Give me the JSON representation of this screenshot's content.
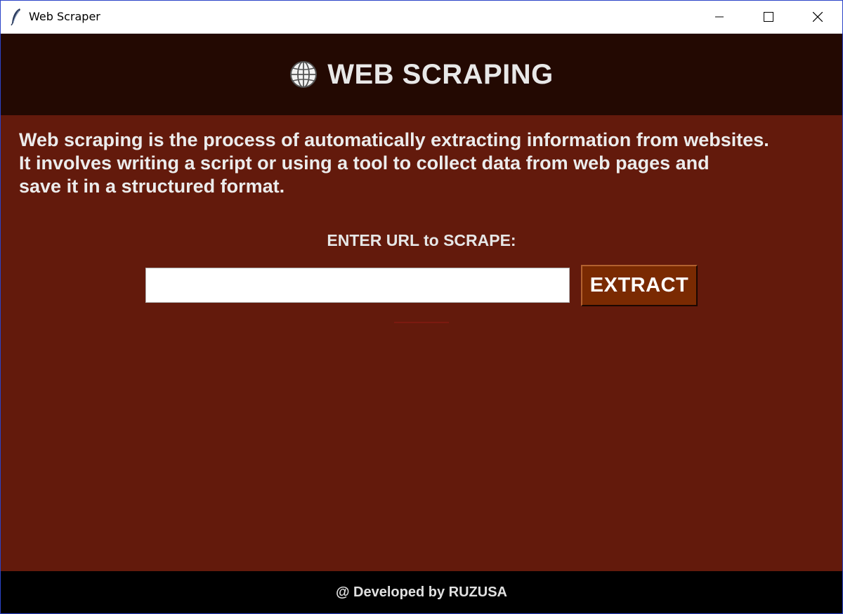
{
  "window": {
    "title": "Web Scraper"
  },
  "header": {
    "title": "WEB SCRAPING",
    "icon": "globe-icon"
  },
  "description": {
    "lines": [
      "Web scraping is the process of automatically extracting information from websites.",
      "It involves writing a script or using a tool to collect data from web pages and",
      "save it in a structured format."
    ]
  },
  "form": {
    "url_label": "ENTER URL to SCRAPE:",
    "url_value": "",
    "url_placeholder": "",
    "extract_label": "EXTRACT"
  },
  "footer": {
    "text": "@ Developed by RUZUSA"
  },
  "colors": {
    "header_bg": "#230902",
    "body_bg": "#631a0c",
    "button_bg": "#7a2a02",
    "footer_bg": "#000000",
    "text": "#ececec"
  }
}
